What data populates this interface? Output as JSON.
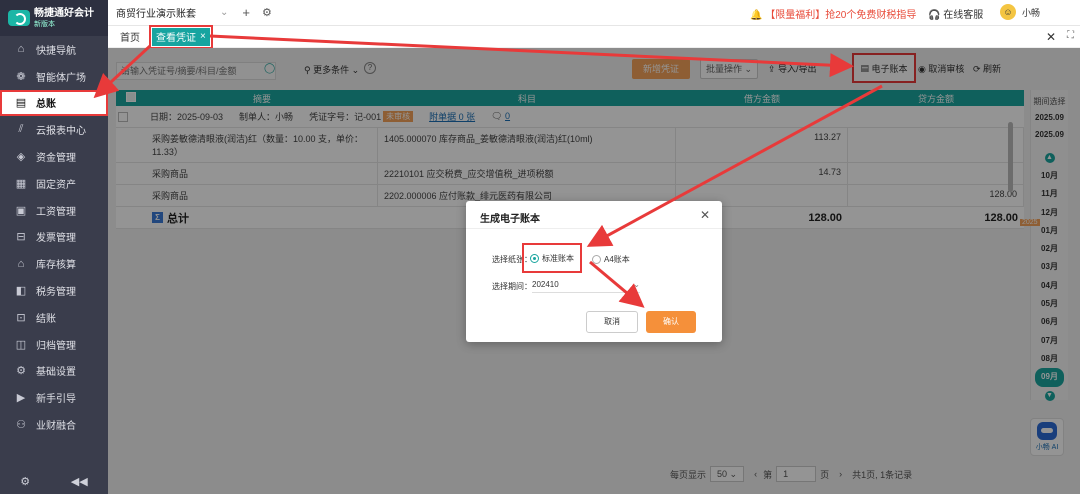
{
  "sidebar": {
    "logo_title": "畅捷通好会计",
    "logo_sub": "新版本",
    "items": [
      {
        "label": "快捷导航",
        "icon": "home-icon"
      },
      {
        "label": "智能体广场",
        "icon": "apps-icon"
      },
      {
        "label": "总账",
        "icon": "ledger-icon"
      },
      {
        "label": "云报表中心",
        "icon": "chart-icon"
      },
      {
        "label": "资金管理",
        "icon": "wallet-icon"
      },
      {
        "label": "固定资产",
        "icon": "building-icon"
      },
      {
        "label": "工资管理",
        "icon": "salary-icon"
      },
      {
        "label": "发票管理",
        "icon": "invoice-icon"
      },
      {
        "label": "库存核算",
        "icon": "warehouse-icon"
      },
      {
        "label": "税务管理",
        "icon": "tax-icon"
      },
      {
        "label": "结账",
        "icon": "checkout-icon"
      },
      {
        "label": "归档管理",
        "icon": "archive-icon"
      },
      {
        "label": "基础设置",
        "icon": "settings-icon"
      },
      {
        "label": "新手引导",
        "icon": "guide-icon"
      },
      {
        "label": "业财融合",
        "icon": "integration-icon"
      }
    ],
    "active_index": 2
  },
  "topbar": {
    "account": "商贸行业演示账套",
    "promo": "【限量福利】抢20个免费财税指导",
    "service": "在线客服",
    "user": "小畅"
  },
  "tabs": {
    "home": "首页",
    "active": "查看凭证"
  },
  "toolbar": {
    "search_placeholder": "请输入凭证号/摘要/科目/金额",
    "more_filter": "更多条件",
    "new_voucher": "新增凭证",
    "batch_ops": "批量操作",
    "import_export": "导入/导出",
    "ebook": "电子账本",
    "cancel_audit": "取消审核",
    "refresh": "刷新"
  },
  "table": {
    "headers": [
      "摘要",
      "科目",
      "借方金额",
      "贷方金额"
    ],
    "meta": {
      "date": "日期：2025-09-03",
      "maker": "制单人：小畅",
      "voucher_no": "凭证字号：记-001",
      "status": "未审核",
      "attachments": "附单据 0 张",
      "comment_count": "0"
    },
    "rows": [
      {
        "summary": "采购姜敏德清眼液(润洁)红（数量：10.00 支，单价：11.33）",
        "account": "1405.000070 库存商品_姜敏德清眼液(润洁)红(10ml)",
        "debit": "113.27",
        "credit": ""
      },
      {
        "summary": "采购商品",
        "account": "22210101 应交税费_应交增值税_进项税额",
        "debit": "14.73",
        "credit": ""
      },
      {
        "summary": "采购商品",
        "account": "2202.000006 应付账款_绯元医药有限公司",
        "debit": "",
        "credit": "128.00"
      }
    ],
    "total_label": "总计",
    "total_debit": "128.00",
    "total_credit": "128.00"
  },
  "period_panel": {
    "title": "期间选择",
    "years": [
      "2025.09",
      "2025.09"
    ],
    "months": [
      "10月",
      "11月",
      "12月",
      "01月",
      "02月",
      "03月",
      "04月",
      "05月",
      "06月",
      "07月",
      "08月",
      "09月"
    ],
    "current": "09月",
    "tag": "2025"
  },
  "ai_button": "小畅 AI",
  "pager": {
    "per_page_label": "每页显示",
    "per_page": "50",
    "page_prefix": "第",
    "page": "1",
    "page_suffix": "页",
    "summary": "共1页, 1条记录"
  },
  "modal": {
    "title": "生成电子账本",
    "paper_label": "选择纸张：",
    "paper_standard": "标准账本",
    "paper_a4": "A4账本",
    "period_label": "选择期间：",
    "period_value": "202410",
    "cancel": "取消",
    "confirm": "确认"
  },
  "colors": {
    "accent": "#1aa59f",
    "orange": "#f5903a",
    "highlight": "#e83a3a",
    "sidebar": "#3a3d4c"
  }
}
